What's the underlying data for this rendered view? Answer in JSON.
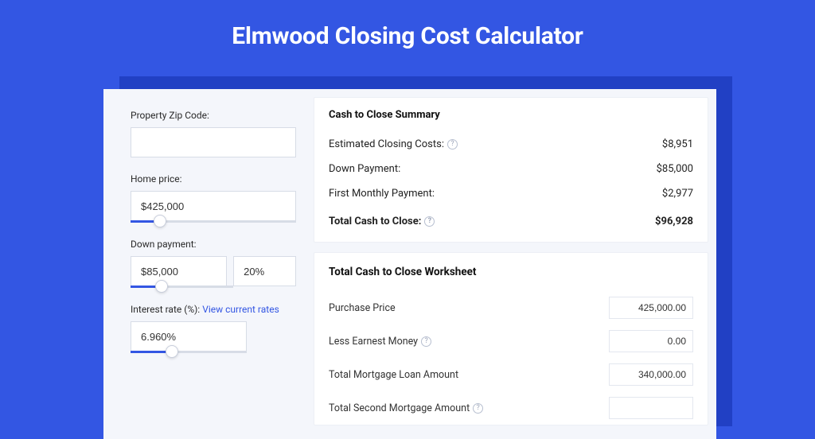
{
  "title": "Elmwood Closing Cost Calculator",
  "sidebar": {
    "zip_label": "Property Zip Code:",
    "zip_value": "",
    "home_price_label": "Home price:",
    "home_price_value": "$425,000",
    "home_price_slider_pct": 18,
    "down_payment_label": "Down payment:",
    "down_payment_value": "$85,000",
    "down_payment_pct_value": "20%",
    "down_payment_slider_pct": 30,
    "interest_label": "Interest rate (%): ",
    "interest_link": "View current rates",
    "interest_value": "6.960%",
    "interest_slider_pct": 36
  },
  "summary": {
    "heading": "Cash to Close Summary",
    "rows": [
      {
        "label": "Estimated Closing Costs:",
        "help": true,
        "value": "$8,951"
      },
      {
        "label": "Down Payment:",
        "help": false,
        "value": "$85,000"
      },
      {
        "label": "First Monthly Payment:",
        "help": false,
        "value": "$2,977"
      }
    ],
    "total_label": "Total Cash to Close:",
    "total_value": "$96,928"
  },
  "worksheet": {
    "heading": "Total Cash to Close Worksheet",
    "rows": [
      {
        "label": "Purchase Price",
        "help": false,
        "value": "425,000.00"
      },
      {
        "label": "Less Earnest Money",
        "help": true,
        "value": "0.00"
      },
      {
        "label": "Total Mortgage Loan Amount",
        "help": false,
        "value": "340,000.00"
      },
      {
        "label": "Total Second Mortgage Amount",
        "help": true,
        "value": ""
      }
    ]
  }
}
